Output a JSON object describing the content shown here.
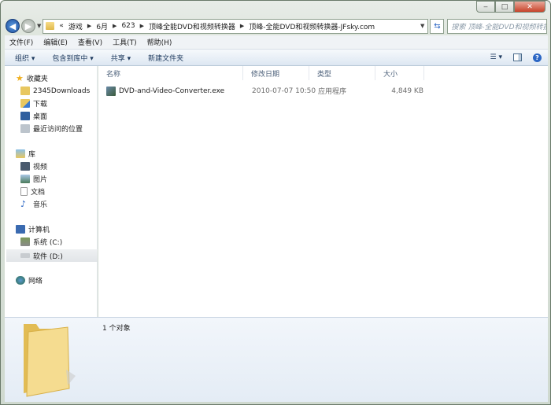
{
  "window": {
    "minimize": "‒",
    "maximize": "□",
    "close": "✕"
  },
  "address": {
    "overflow": "«",
    "crumbs": [
      "游戏",
      "6月",
      "623",
      "顶峰全能DVD和视频转换器",
      "顶峰-全能DVD和视频转换器-JFsky.com"
    ],
    "search_placeholder": "搜索 顶峰-全能DVD和视频转换器-JF..."
  },
  "menu": [
    "文件(F)",
    "编辑(E)",
    "查看(V)",
    "工具(T)",
    "帮助(H)"
  ],
  "toolbar": {
    "organize": "组织 ▾",
    "include": "包含到库中 ▾",
    "share": "共享 ▾",
    "new_folder": "新建文件夹"
  },
  "sidebar": {
    "favorites": {
      "label": "收藏夹",
      "items": [
        "2345Downloads",
        "下载",
        "桌面",
        "最近访问的位置"
      ]
    },
    "libraries": {
      "label": "库",
      "items": [
        "视频",
        "图片",
        "文档",
        "音乐"
      ]
    },
    "computer": {
      "label": "计算机",
      "items": [
        "系统 (C:)",
        "软件 (D:)"
      ]
    },
    "network": {
      "label": "网络"
    }
  },
  "columns": [
    "名称",
    "修改日期",
    "类型",
    "大小"
  ],
  "files": [
    {
      "name": "DVD-and-Video-Converter.exe",
      "modified": "2010-07-07 10:50",
      "type": "应用程序",
      "size": "4,849 KB"
    }
  ],
  "details": {
    "count": "1 个对象"
  }
}
